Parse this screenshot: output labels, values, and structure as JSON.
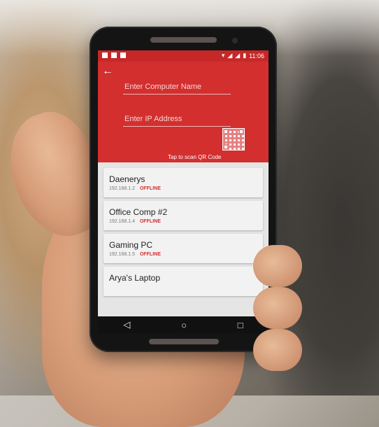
{
  "status_bar": {
    "time": "11:06",
    "icons": [
      "notification-icon",
      "download-icon",
      "image-icon",
      "wifi-icon",
      "signal-icon",
      "battery-icon"
    ]
  },
  "app_bar": {
    "back_icon": "arrow-left-icon",
    "computer_name_placeholder": "Enter Computer Name",
    "ip_placeholder": "Enter IP Address",
    "qr_caption": "Tap to scan QR Code",
    "accent": "#d32f2f"
  },
  "computers": [
    {
      "name": "Daenerys",
      "ip": "192.168.1.2",
      "status": "OFFLINE"
    },
    {
      "name": "Office Comp #2",
      "ip": "192.168.1.4",
      "status": "OFFLINE"
    },
    {
      "name": "Gaming PC",
      "ip": "192.168.1.5",
      "status": "OFFLINE"
    },
    {
      "name": "Arya's Laptop",
      "ip": "",
      "status": ""
    }
  ],
  "fab": {
    "label": "+",
    "icon": "plus-icon"
  },
  "nav": {
    "back": "◁",
    "home": "○",
    "recent": "□"
  }
}
